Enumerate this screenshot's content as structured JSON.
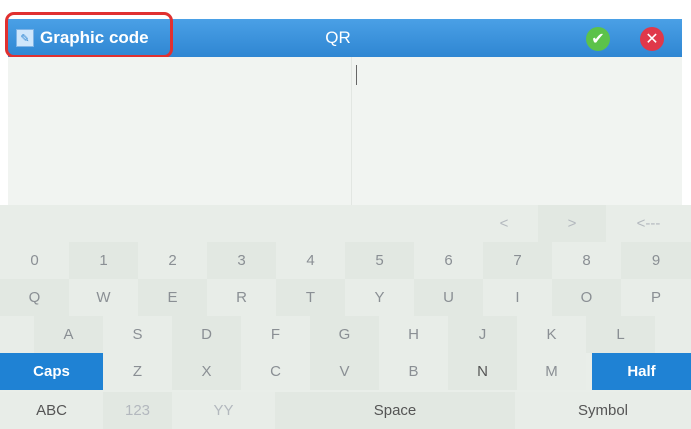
{
  "titlebar": {
    "title": "Graphic  code",
    "center_label": "QR",
    "ok_icon": "check-icon",
    "cancel_icon": "close-icon"
  },
  "keyboard": {
    "nav": [
      "<",
      ">",
      "<---"
    ],
    "digits": [
      "0",
      "1",
      "2",
      "3",
      "4",
      "5",
      "6",
      "7",
      "8",
      "9"
    ],
    "row_q": [
      "Q",
      "W",
      "E",
      "R",
      "T",
      "Y",
      "U",
      "I",
      "O",
      "P"
    ],
    "row_a": [
      "A",
      "S",
      "D",
      "F",
      "G",
      "H",
      "J",
      "K",
      "L"
    ],
    "row_z": {
      "caps": "Caps",
      "letters": [
        "Z",
        "X",
        "C",
        "V",
        "B",
        "N",
        "M"
      ],
      "half": "Half"
    },
    "bottom": {
      "abc": "ABC",
      "num": "123",
      "yy": "YY",
      "space": "Space",
      "symbol": "Symbol"
    }
  },
  "colors": {
    "titlebar": "#2f86d2",
    "accent_key": "#1f82d4",
    "ok": "#5cc24a",
    "cancel": "#e0384a",
    "highlight": "#e03030"
  }
}
